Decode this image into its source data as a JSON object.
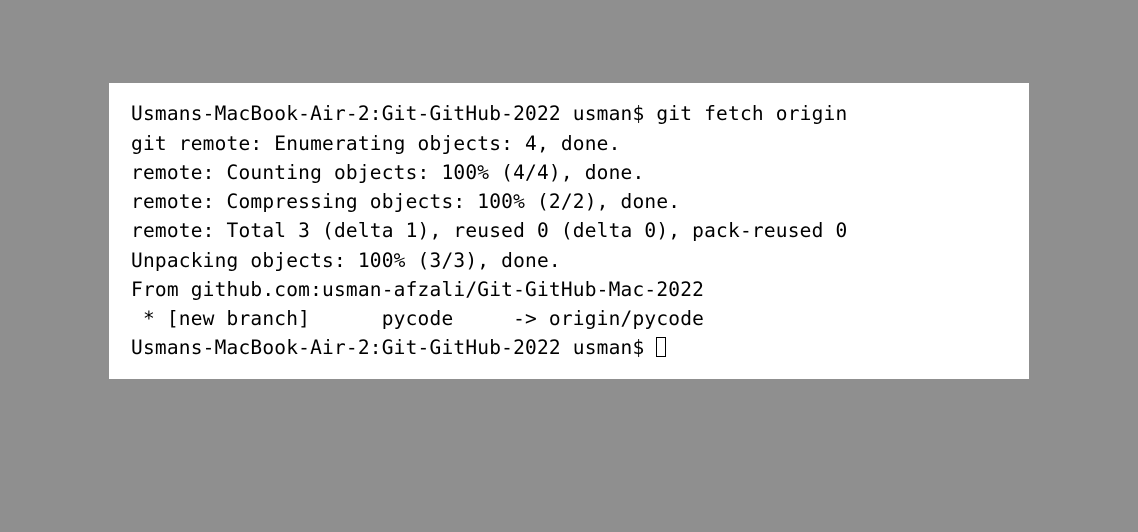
{
  "terminal": {
    "lines": [
      "Usmans-MacBook-Air-2:Git-GitHub-2022 usman$ git fetch origin",
      "git remote: Enumerating objects: 4, done.",
      "remote: Counting objects: 100% (4/4), done.",
      "remote: Compressing objects: 100% (2/2), done.",
      "remote: Total 3 (delta 1), reused 0 (delta 0), pack-reused 0",
      "Unpacking objects: 100% (3/3), done.",
      "From github.com:usman-afzali/Git-GitHub-Mac-2022",
      " * [new branch]      pycode     -> origin/pycode",
      "Usmans-MacBook-Air-2:Git-GitHub-2022 usman$ "
    ]
  }
}
